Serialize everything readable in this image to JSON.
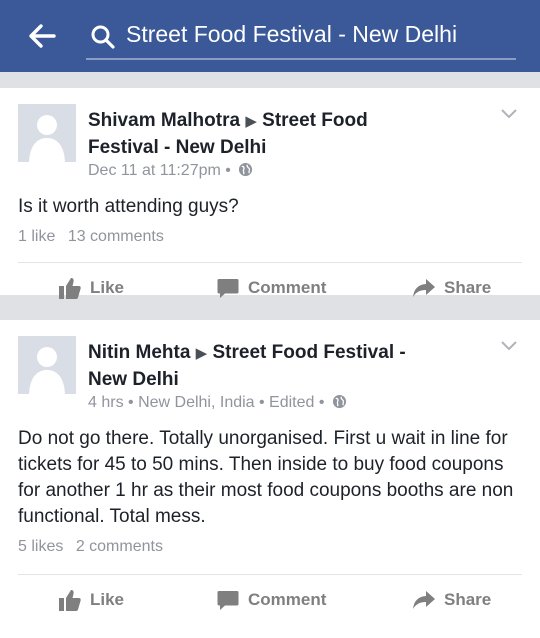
{
  "header": {
    "search_text": "Street Food Festival - New Delhi"
  },
  "posts": [
    {
      "author": "Shivam Malhotra",
      "target": "Street Food Festival - New Delhi",
      "meta": "Dec 11 at 11:27pm •",
      "body": "Is it worth attending guys?",
      "likes": "1 like",
      "comments": "13 comments",
      "actions": {
        "like": "Like",
        "comment": "Comment",
        "share": "Share"
      }
    },
    {
      "author": "Nitin Mehta",
      "target": "Street Food Festival - New Delhi",
      "meta": "4 hrs • New Delhi, India • Edited •",
      "body": "Do not go there. Totally unorganised. First u wait in line for tickets for 45 to 50 mins. Then inside to buy food coupons for another 1 hr as their most food coupons booths are non functional. Total mess.",
      "likes": "5 likes",
      "comments": "2 comments",
      "actions": {
        "like": "Like",
        "comment": "Comment",
        "share": "Share"
      }
    }
  ],
  "colors": {
    "brand": "#3b5998",
    "text": "#1d2129",
    "muted": "#90949c",
    "action": "#7f7f7f"
  },
  "icons": [
    "back-arrow-icon",
    "search-icon",
    "chevron-down-icon",
    "globe-icon",
    "like-icon",
    "comment-icon",
    "share-icon",
    "avatar-placeholder-icon"
  ]
}
